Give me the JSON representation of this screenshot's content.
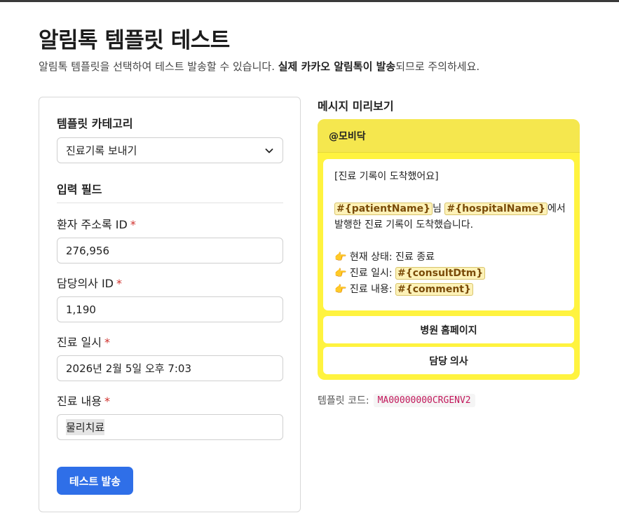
{
  "page": {
    "title": "알림톡 템플릿 테스트",
    "subtitle_prefix": "알림톡 템플릿을 선택하여 테스트 발송할 수 있습니다. ",
    "subtitle_bold": "실제 카카오 알림톡이 발송",
    "subtitle_suffix": "되므로 주의하세요."
  },
  "form": {
    "category_label": "템플릿 카테고리",
    "category_value": "진료기록 보내기",
    "input_section_label": "입력 필드",
    "required_mark": "*",
    "fields": [
      {
        "label": "환자 주소록 ID",
        "value": "276,956"
      },
      {
        "label": "담당의사 ID",
        "value": "1,190"
      },
      {
        "label": "진료 일시",
        "value": "2026년 2월 5일 오후 7:03"
      },
      {
        "label": "진료 내용",
        "value": "물리치료"
      }
    ],
    "submit_label": "테스트 발송"
  },
  "preview": {
    "heading": "메시지 미리보기",
    "sender": "@모비닥",
    "message": {
      "title": "[진료 기록이 도착했어요]",
      "var_patient": "#{patientName}",
      "text_nim": "님 ",
      "var_hospital": "#{hospitalName}",
      "text_eseo": "에서",
      "line2": "발행한 진료 기록이 도착했습니다.",
      "pointer": "👉",
      "status_text": " 현재 상태: 진료 종료",
      "date_label": " 진료 일시: ",
      "var_date": "#{consultDtm}",
      "content_label": " 진료 내용: ",
      "var_comment": "#{comment}"
    },
    "buttons": [
      "병원 홈페이지",
      "담당 의사"
    ],
    "template_code_label": "템플릿 코드:",
    "template_code": "MA00000000CRGENV2"
  },
  "colors": {
    "accent": "#2f6fe8",
    "kakao_yellow": "#fff33f",
    "required": "#d0312d",
    "code": "#c2185b"
  },
  "icons": {
    "select_chevron": "chevron-down-icon",
    "pointer": "backhand-index-pointing-right-icon"
  }
}
